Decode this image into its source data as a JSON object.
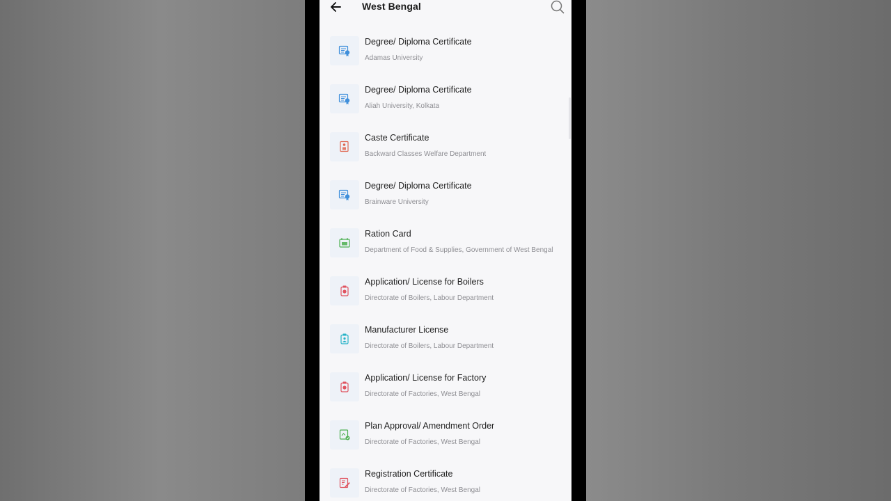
{
  "header": {
    "title": "West Bengal"
  },
  "icons": {
    "back": "arrow-left-icon",
    "search": "search-icon"
  },
  "items": [
    {
      "title": "Degree/ Diploma Certificate",
      "subtitle": "Adamas University",
      "icon": "degree-certificate-icon",
      "color": "#3f8fdb"
    },
    {
      "title": "Degree/ Diploma Certificate",
      "subtitle": "Aliah University, Kolkata",
      "icon": "degree-certificate-icon",
      "color": "#3f8fdb"
    },
    {
      "title": "Caste Certificate",
      "subtitle": "Backward Classes Welfare Department",
      "icon": "caste-certificate-icon",
      "color": "#e0654f"
    },
    {
      "title": "Degree/ Diploma Certificate",
      "subtitle": "Brainware University",
      "icon": "degree-certificate-icon",
      "color": "#3f8fdb"
    },
    {
      "title": "Ration Card",
      "subtitle": "Department of Food & Supplies, Government of West Bengal",
      "icon": "ration-card-icon",
      "color": "#4caf50"
    },
    {
      "title": "Application/ License for Boilers",
      "subtitle": "Directorate of Boilers, Labour Department",
      "icon": "license-icon",
      "color": "#e0535f"
    },
    {
      "title": "Manufacturer License",
      "subtitle": "Directorate of Boilers, Labour Department",
      "icon": "manufacturer-license-icon",
      "color": "#26b3c7"
    },
    {
      "title": "Application/ License for Factory",
      "subtitle": "Directorate of Factories, West Bengal",
      "icon": "license-icon",
      "color": "#e0535f"
    },
    {
      "title": "Plan Approval/ Amendment Order",
      "subtitle": "Directorate of Factories, West Bengal",
      "icon": "plan-approval-icon",
      "color": "#4caf50"
    },
    {
      "title": "Registration Certificate",
      "subtitle": "Directorate of Factories, West Bengal",
      "icon": "registration-certificate-icon",
      "color": "#e0535f"
    }
  ]
}
